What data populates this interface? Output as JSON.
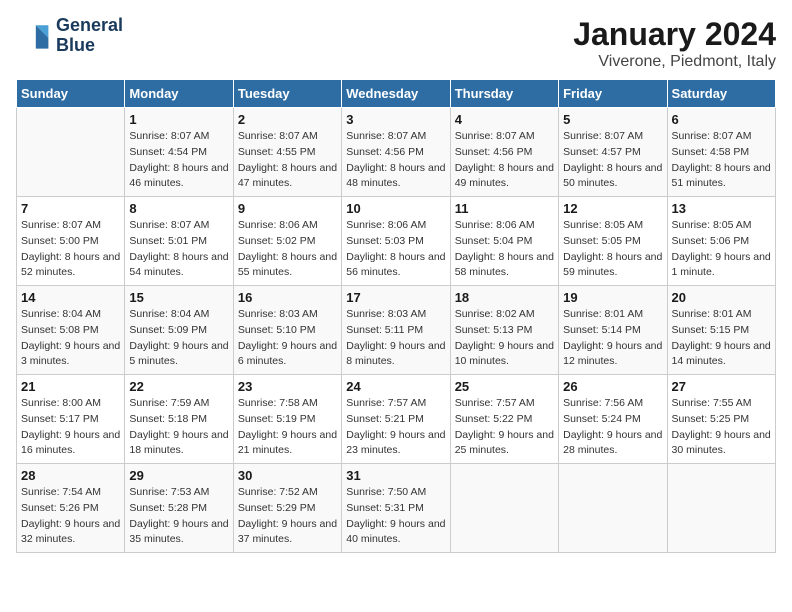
{
  "header": {
    "logo_line1": "General",
    "logo_line2": "Blue",
    "month": "January 2024",
    "location": "Viverone, Piedmont, Italy"
  },
  "weekdays": [
    "Sunday",
    "Monday",
    "Tuesday",
    "Wednesday",
    "Thursday",
    "Friday",
    "Saturday"
  ],
  "weeks": [
    [
      {
        "day": "",
        "sunrise": "",
        "sunset": "",
        "daylight": ""
      },
      {
        "day": "1",
        "sunrise": "8:07 AM",
        "sunset": "4:54 PM",
        "daylight": "8 hours and 46 minutes."
      },
      {
        "day": "2",
        "sunrise": "8:07 AM",
        "sunset": "4:55 PM",
        "daylight": "8 hours and 47 minutes."
      },
      {
        "day": "3",
        "sunrise": "8:07 AM",
        "sunset": "4:56 PM",
        "daylight": "8 hours and 48 minutes."
      },
      {
        "day": "4",
        "sunrise": "8:07 AM",
        "sunset": "4:56 PM",
        "daylight": "8 hours and 49 minutes."
      },
      {
        "day": "5",
        "sunrise": "8:07 AM",
        "sunset": "4:57 PM",
        "daylight": "8 hours and 50 minutes."
      },
      {
        "day": "6",
        "sunrise": "8:07 AM",
        "sunset": "4:58 PM",
        "daylight": "8 hours and 51 minutes."
      }
    ],
    [
      {
        "day": "7",
        "sunrise": "8:07 AM",
        "sunset": "5:00 PM",
        "daylight": "8 hours and 52 minutes."
      },
      {
        "day": "8",
        "sunrise": "8:07 AM",
        "sunset": "5:01 PM",
        "daylight": "8 hours and 54 minutes."
      },
      {
        "day": "9",
        "sunrise": "8:06 AM",
        "sunset": "5:02 PM",
        "daylight": "8 hours and 55 minutes."
      },
      {
        "day": "10",
        "sunrise": "8:06 AM",
        "sunset": "5:03 PM",
        "daylight": "8 hours and 56 minutes."
      },
      {
        "day": "11",
        "sunrise": "8:06 AM",
        "sunset": "5:04 PM",
        "daylight": "8 hours and 58 minutes."
      },
      {
        "day": "12",
        "sunrise": "8:05 AM",
        "sunset": "5:05 PM",
        "daylight": "8 hours and 59 minutes."
      },
      {
        "day": "13",
        "sunrise": "8:05 AM",
        "sunset": "5:06 PM",
        "daylight": "9 hours and 1 minute."
      }
    ],
    [
      {
        "day": "14",
        "sunrise": "8:04 AM",
        "sunset": "5:08 PM",
        "daylight": "9 hours and 3 minutes."
      },
      {
        "day": "15",
        "sunrise": "8:04 AM",
        "sunset": "5:09 PM",
        "daylight": "9 hours and 5 minutes."
      },
      {
        "day": "16",
        "sunrise": "8:03 AM",
        "sunset": "5:10 PM",
        "daylight": "9 hours and 6 minutes."
      },
      {
        "day": "17",
        "sunrise": "8:03 AM",
        "sunset": "5:11 PM",
        "daylight": "9 hours and 8 minutes."
      },
      {
        "day": "18",
        "sunrise": "8:02 AM",
        "sunset": "5:13 PM",
        "daylight": "9 hours and 10 minutes."
      },
      {
        "day": "19",
        "sunrise": "8:01 AM",
        "sunset": "5:14 PM",
        "daylight": "9 hours and 12 minutes."
      },
      {
        "day": "20",
        "sunrise": "8:01 AM",
        "sunset": "5:15 PM",
        "daylight": "9 hours and 14 minutes."
      }
    ],
    [
      {
        "day": "21",
        "sunrise": "8:00 AM",
        "sunset": "5:17 PM",
        "daylight": "9 hours and 16 minutes."
      },
      {
        "day": "22",
        "sunrise": "7:59 AM",
        "sunset": "5:18 PM",
        "daylight": "9 hours and 18 minutes."
      },
      {
        "day": "23",
        "sunrise": "7:58 AM",
        "sunset": "5:19 PM",
        "daylight": "9 hours and 21 minutes."
      },
      {
        "day": "24",
        "sunrise": "7:57 AM",
        "sunset": "5:21 PM",
        "daylight": "9 hours and 23 minutes."
      },
      {
        "day": "25",
        "sunrise": "7:57 AM",
        "sunset": "5:22 PM",
        "daylight": "9 hours and 25 minutes."
      },
      {
        "day": "26",
        "sunrise": "7:56 AM",
        "sunset": "5:24 PM",
        "daylight": "9 hours and 28 minutes."
      },
      {
        "day": "27",
        "sunrise": "7:55 AM",
        "sunset": "5:25 PM",
        "daylight": "9 hours and 30 minutes."
      }
    ],
    [
      {
        "day": "28",
        "sunrise": "7:54 AM",
        "sunset": "5:26 PM",
        "daylight": "9 hours and 32 minutes."
      },
      {
        "day": "29",
        "sunrise": "7:53 AM",
        "sunset": "5:28 PM",
        "daylight": "9 hours and 35 minutes."
      },
      {
        "day": "30",
        "sunrise": "7:52 AM",
        "sunset": "5:29 PM",
        "daylight": "9 hours and 37 minutes."
      },
      {
        "day": "31",
        "sunrise": "7:50 AM",
        "sunset": "5:31 PM",
        "daylight": "9 hours and 40 minutes."
      },
      {
        "day": "",
        "sunrise": "",
        "sunset": "",
        "daylight": ""
      },
      {
        "day": "",
        "sunrise": "",
        "sunset": "",
        "daylight": ""
      },
      {
        "day": "",
        "sunrise": "",
        "sunset": "",
        "daylight": ""
      }
    ]
  ],
  "labels": {
    "sunrise_prefix": "Sunrise: ",
    "sunset_prefix": "Sunset: ",
    "daylight_prefix": "Daylight: "
  }
}
